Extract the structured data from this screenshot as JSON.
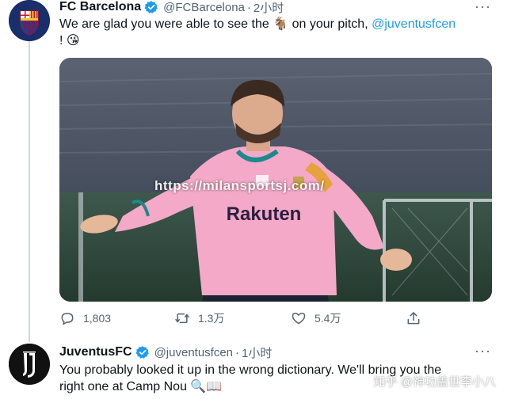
{
  "tweet1": {
    "name": "FC Barcelona",
    "handle": "@FCBarcelona",
    "sep": "·",
    "time": "2小时",
    "text_line1_before": "We are glad you were able to see the",
    "text_line1_goat": "🐐",
    "text_line1_after": " on your pitch, ",
    "mention": "@juventusfcen",
    "text_line2": "!",
    "emoji": "😘",
    "media": {
      "sponsor": "Rakuten",
      "watermark": "https://milansportsj.com/"
    },
    "actions": {
      "replies": "1,803",
      "retweets": "1.3万",
      "likes": "5.4万"
    }
  },
  "tweet2": {
    "name": "JuventusFC",
    "handle": "@juventusfcen",
    "sep": "·",
    "time": "1小时",
    "text_line1": "You probably looked it up in the wrong dictionary. We'll bring you the",
    "text_line2": "right one at Camp Nou ",
    "emoji": "🔍📖"
  },
  "more_label": "···",
  "zhihu_watermark": "知乎 @神功盖世李小八",
  "colors": {
    "accent": "#1d9bf0",
    "verified": "#1d9bf0",
    "jersey": "#f2a7c8"
  }
}
